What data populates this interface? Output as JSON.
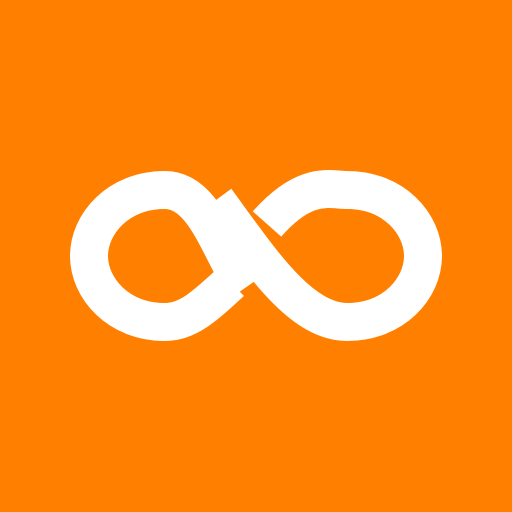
{
  "icon": {
    "name": "infinity-icon",
    "background_color": "#FF7F00",
    "foreground_color": "#FFFFFF"
  }
}
